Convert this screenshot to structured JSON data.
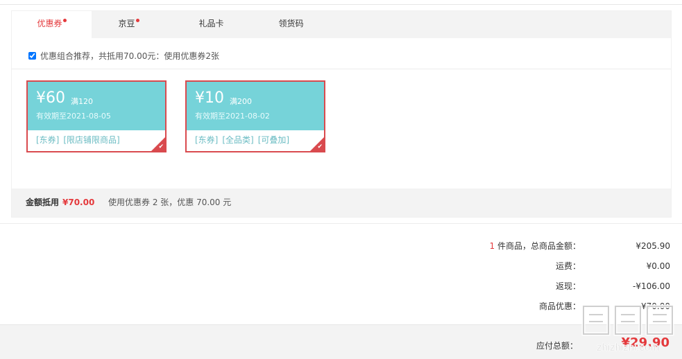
{
  "tabs": [
    {
      "label": "优惠券",
      "active": true,
      "dot": true
    },
    {
      "label": "京豆",
      "active": false,
      "dot": true
    },
    {
      "label": "礼品卡",
      "active": false,
      "dot": false
    },
    {
      "label": "领货码",
      "active": false,
      "dot": false
    }
  ],
  "recommend": {
    "checked": true,
    "text": "优惠组合推荐，共抵用70.00元：使用优惠券2张"
  },
  "coupons": [
    {
      "amount": "¥60",
      "limit": "满120",
      "expiry": "有效期至2021-08-05",
      "tags": [
        "[东券]",
        "[限店铺限商品]"
      ],
      "selected": true
    },
    {
      "amount": "¥10",
      "limit": "满200",
      "expiry": "有效期至2021-08-02",
      "tags": [
        "[东券]",
        "[全品类]",
        "[可叠加]"
      ],
      "selected": true
    }
  ],
  "summary": {
    "label": "金额抵用",
    "amount": "¥70.00",
    "desc": "使用优惠券 2 张，优惠 70.00 元"
  },
  "totals": {
    "items_count": "1",
    "items_label": "件商品，总商品金额：",
    "items_value": "¥205.90",
    "shipping_label": "运费：",
    "shipping_value": "¥0.00",
    "cashback_label": "返现：",
    "cashback_value": "-¥106.00",
    "discount_label": "商品优惠：",
    "discount_value": "¥70.00"
  },
  "payable": {
    "label": "应付总额：",
    "amount": "¥29.90"
  },
  "watermark": {
    "text": "zhizhizhi.com"
  },
  "colors": {
    "accent": "#e4393c",
    "coupon_bg": "#76d3d9",
    "coupon_border": "#d94a4e"
  },
  "icons": {
    "check": "check-icon",
    "badge_dot": "badge-dot-icon"
  }
}
